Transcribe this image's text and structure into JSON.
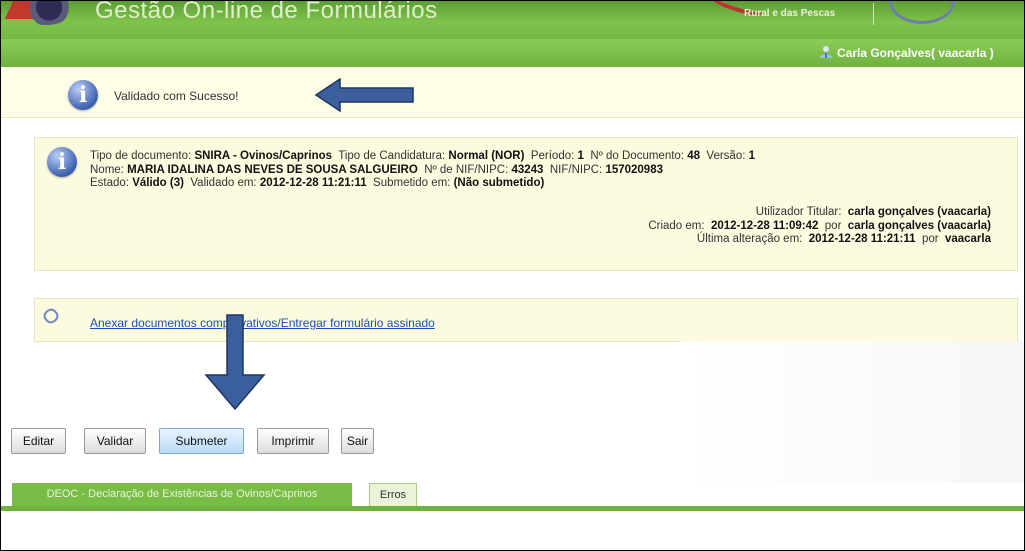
{
  "header": {
    "app_title": "Gestão On-line de Formulários",
    "ministry_text": "Rural e das Pescas"
  },
  "user": {
    "name": "Carla Gonçalves( vaacarla )"
  },
  "success_message": "Validado com Sucesso!",
  "document": {
    "line1": [
      {
        "label": "Tipo de documento:",
        "value": "SNIRA - Ovinos/Caprinos"
      },
      {
        "label": "Tipo de Candidatura:",
        "value": "Normal (NOR)"
      },
      {
        "label": "Período:",
        "value": "1"
      },
      {
        "label": "Nº do Documento:",
        "value": "48"
      },
      {
        "label": "Versão:",
        "value": "1"
      }
    ],
    "line2": [
      {
        "label": "Nome:",
        "value": "MARIA IDALINA DAS NEVES DE SOUSA SALGUEIRO"
      },
      {
        "label": "Nº de NIF/NIPC:",
        "value": "43243"
      },
      {
        "label": "NIF/NIPC:",
        "value": "157020983"
      }
    ],
    "line3": [
      {
        "label": "Estado:",
        "value": "Válido (3)"
      },
      {
        "label": "Validado em:",
        "value": "2012-12-28 11:21:11"
      },
      {
        "label": "Submetido em:",
        "value": "(Não submetido)"
      }
    ],
    "utilizador_label": "Utilizador Titular:",
    "utilizador_value": "carla gonçalves (vaacarla)",
    "criado_label": "Criado em:",
    "criado_date": "2012-12-28 11:09:42",
    "criado_por": "por",
    "criado_user": "carla gonçalves (vaacarla)",
    "alteracao_label": "Última alteração em:",
    "alteracao_date": "2012-12-28 11:21:11",
    "alteracao_por": "por",
    "alteracao_user": "vaacarla"
  },
  "attach_link": "Anexar documentos comprovativos/Entregar formulário assinado",
  "buttons": {
    "editar": "Editar",
    "validar": "Validar",
    "submeter": "Submeter",
    "imprimir": "Imprimir",
    "sair": "Sair"
  },
  "tabs": {
    "deoc": "DEOC - Declaração de Existências de Ovinos/Caprinos",
    "erros": "Erros"
  },
  "colors": {
    "header_green": "#7fc34b",
    "annotation_arrow": "#3a5f9c",
    "info_panel": "#fcfbdf"
  }
}
